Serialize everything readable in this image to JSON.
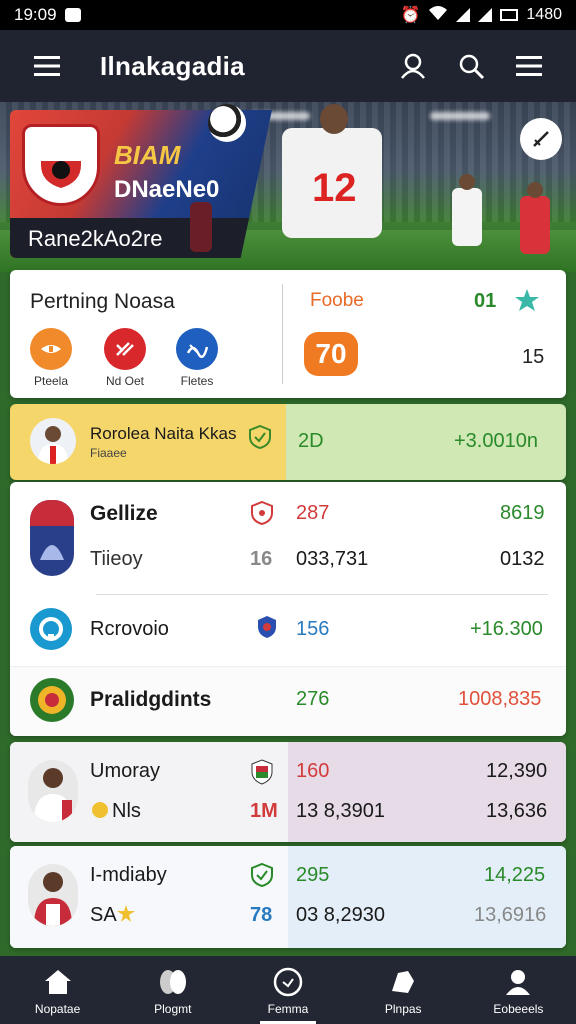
{
  "status_bar": {
    "time": "19:09",
    "right_text": "1480"
  },
  "app_bar": {
    "title": "Ilnakagadia"
  },
  "hero": {
    "banner_line1": "BIAM",
    "banner_line2": "DNaeNe0",
    "banner_line3": "Rane2kAo2re",
    "jersey_number": "12"
  },
  "summary_card": {
    "title": "Pertning Noasa",
    "chips": [
      {
        "label": "Pteela",
        "color": "#f08a2a"
      },
      {
        "label": "Nd Oet",
        "color": "#d8282b"
      },
      {
        "label": "Fletes",
        "color": "#1e5fbf"
      }
    ],
    "right_label": "Foobe",
    "right_value": "01",
    "score": "70",
    "right_bottom_value": "15"
  },
  "highlight_row": {
    "name": "Rorolea Naita Kkas",
    "sub": "Fiaaee",
    "value": "2D",
    "amount": "+3.0010n"
  },
  "list_card": {
    "rows": [
      {
        "name": "Gellize",
        "num_a": "287",
        "num_b": "8619",
        "sub": "Tiieoy",
        "sub_num": "16",
        "val_a": "033,731",
        "val_b": "0132"
      },
      {
        "name": "Rcrovoio",
        "num_a": "156",
        "num_b": "+16.300"
      },
      {
        "name": "Pralidgdints",
        "num_a": "276",
        "num_b": "1008,835"
      }
    ]
  },
  "player_cards": [
    {
      "name": "Umoray",
      "sub": "Nls",
      "num_a": "160",
      "val_a": "12,390",
      "tag": "1M",
      "val_b": "13 8,3901",
      "val_c": "13,636"
    },
    {
      "name": "I-mdiaby",
      "sub": "SA",
      "num_a": "295",
      "val_a": "14,225",
      "tag": "78",
      "val_b": "03 8,2930",
      "val_c": "13,6916"
    }
  ],
  "bottom_nav": [
    {
      "label": "Nopatae",
      "icon": "home-icon"
    },
    {
      "label": "Plogmt",
      "icon": "players-icon"
    },
    {
      "label": "Femma",
      "icon": "match-icon"
    },
    {
      "label": "Plnpas",
      "icon": "stats-icon"
    },
    {
      "label": "Eobeeels",
      "icon": "profile-icon"
    }
  ]
}
